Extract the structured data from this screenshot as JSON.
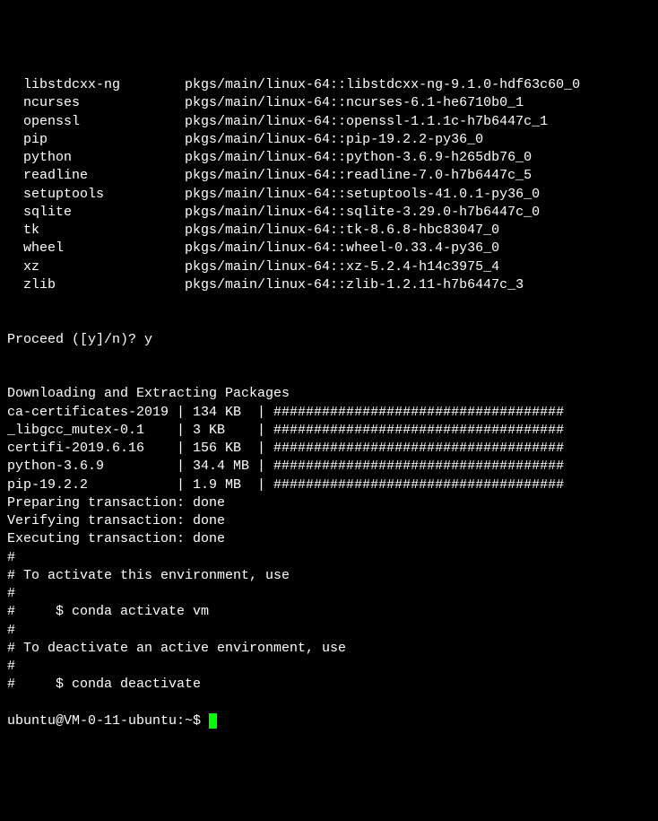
{
  "packages": [
    {
      "name": "libstdcxx-ng",
      "path": "pkgs/main/linux-64::libstdcxx-ng-9.1.0-hdf63c60_0"
    },
    {
      "name": "ncurses",
      "path": "pkgs/main/linux-64::ncurses-6.1-he6710b0_1"
    },
    {
      "name": "openssl",
      "path": "pkgs/main/linux-64::openssl-1.1.1c-h7b6447c_1"
    },
    {
      "name": "pip",
      "path": "pkgs/main/linux-64::pip-19.2.2-py36_0"
    },
    {
      "name": "python",
      "path": "pkgs/main/linux-64::python-3.6.9-h265db76_0"
    },
    {
      "name": "readline",
      "path": "pkgs/main/linux-64::readline-7.0-h7b6447c_5"
    },
    {
      "name": "setuptools",
      "path": "pkgs/main/linux-64::setuptools-41.0.1-py36_0"
    },
    {
      "name": "sqlite",
      "path": "pkgs/main/linux-64::sqlite-3.29.0-h7b6447c_0"
    },
    {
      "name": "tk",
      "path": "pkgs/main/linux-64::tk-8.6.8-hbc83047_0"
    },
    {
      "name": "wheel",
      "path": "pkgs/main/linux-64::wheel-0.33.4-py36_0"
    },
    {
      "name": "xz",
      "path": "pkgs/main/linux-64::xz-5.2.4-h14c3975_4"
    },
    {
      "name": "zlib",
      "path": "pkgs/main/linux-64::zlib-1.2.11-h7b6447c_3"
    }
  ],
  "proceed_prompt": "Proceed ([y]/n)? y",
  "dl_header": "Downloading and Extracting Packages",
  "downloads": [
    {
      "name": "ca-certificates-2019",
      "size": "134 KB",
      "bar": "####################################"
    },
    {
      "name": "_libgcc_mutex-0.1",
      "size": "3 KB",
      "bar": "####################################"
    },
    {
      "name": "certifi-2019.6.16",
      "size": "156 KB",
      "bar": "####################################"
    },
    {
      "name": "python-3.6.9",
      "size": "34.4 MB",
      "bar": "####################################"
    },
    {
      "name": "pip-19.2.2",
      "size": "1.9 MB",
      "bar": "####################################"
    }
  ],
  "transactions": [
    "Preparing transaction: done",
    "Verifying transaction: done",
    "Executing transaction: done"
  ],
  "instructions": [
    "#",
    "# To activate this environment, use",
    "#",
    "#     $ conda activate vm",
    "#",
    "# To deactivate an active environment, use",
    "#",
    "#     $ conda deactivate"
  ],
  "shell_prompt": "ubuntu@VM-0-11-ubuntu:~$ "
}
